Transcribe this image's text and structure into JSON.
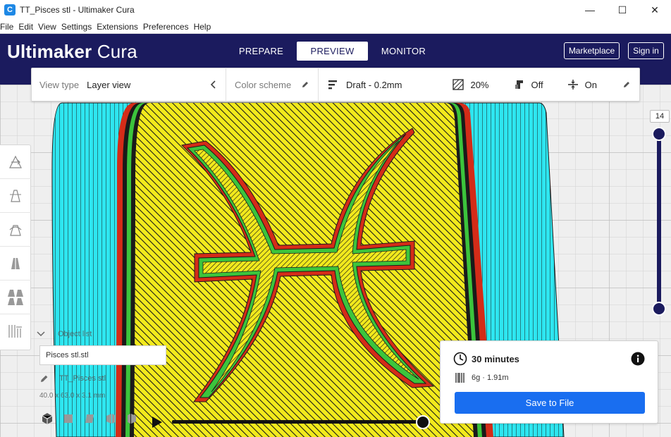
{
  "window": {
    "title": "TT_Pisces stl - Ultimaker Cura",
    "minimize_glyph": "—",
    "maximize_glyph": "☐",
    "close_glyph": "✕"
  },
  "menu": [
    "File",
    "Edit",
    "View",
    "Settings",
    "Extensions",
    "Preferences",
    "Help"
  ],
  "header": {
    "brand_bold": "Ultimaker",
    "brand_light": "Cura",
    "stages": [
      {
        "label": "PREPARE",
        "active": false
      },
      {
        "label": "PREVIEW",
        "active": true
      },
      {
        "label": "MONITOR",
        "active": false
      }
    ],
    "marketplace_label": "Marketplace",
    "signin_label": "Sign in"
  },
  "toolbar": {
    "view_type_label": "View type",
    "view_type_value": "Layer view",
    "color_scheme_label": "Color scheme",
    "profile_label": "Draft - 0.2mm",
    "infill_label": "20%",
    "support_label": "Off",
    "adhesion_label": "On"
  },
  "tools": [
    "move-tool",
    "scale-tool",
    "rotate-tool",
    "mirror-tool",
    "per-model-settings-tool",
    "support-blocker-tool"
  ],
  "object_list": {
    "header": "Object list",
    "item": "Pisces stl.stl",
    "selected_name": "TT_Pisces stl",
    "dimensions": "40.0 x 63.0 x 3.1 mm"
  },
  "layer_slider": {
    "current_layer": "14",
    "level_fraction": 1.0
  },
  "print_info": {
    "time": "30 minutes",
    "material": "6g · 1.91m",
    "save_label": "Save to File"
  },
  "playback": {
    "progress_fraction": 1.0
  },
  "colors": {
    "header_bg": "#1b1b5e",
    "accent_blue": "#196ef0",
    "infill_yellow": "#f2ea1c",
    "wall_outer_red": "#d42c18",
    "wall_inner_green": "#3cc43c",
    "skirt_cyan": "#2ee6f0",
    "slider_dark": "#1b1b5e"
  }
}
